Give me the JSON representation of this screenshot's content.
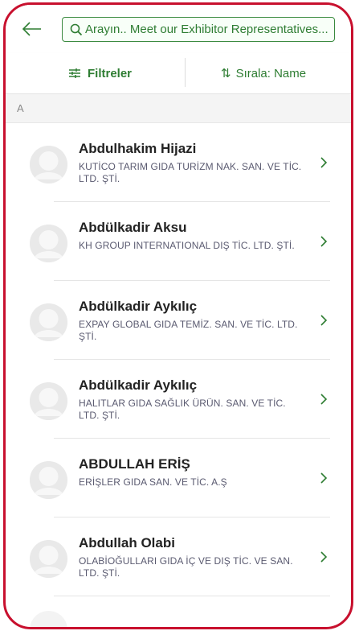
{
  "header": {
    "search": {
      "text": "Arayın.. Meet our Exhibitor Representatives..."
    }
  },
  "toolbar": {
    "filter_label": "Filtreler",
    "sort_label": "Sırala: Name"
  },
  "section": {
    "letter": "A"
  },
  "contacts": [
    {
      "name": "Abdulhakim Hijazi",
      "company": "KUTİCO TARIM GIDA TURİZM NAK. SAN. VE TİC. LTD. ŞTİ."
    },
    {
      "name": "Abdülkadir Aksu",
      "company": "KH GROUP INTERNATIONAL DIŞ TİC. LTD. ŞTİ."
    },
    {
      "name": "Abdülkadir Aykılıç",
      "company": "EXPAY GLOBAL GIDA TEMİZ. SAN. VE TİC. LTD. ŞTİ."
    },
    {
      "name": "Abdülkadir Aykılıç",
      "company": "HALITLAR GIDA SAĞLIK ÜRÜN. SAN. VE TİC. LTD. ŞTİ."
    },
    {
      "name": "ABDULLAH ERİŞ",
      "company": "ERİŞLER GIDA SAN. VE TİC. A.Ş"
    },
    {
      "name": "Abdullah Olabi",
      "company": "OLABİOĞULLARI GIDA İÇ VE DIŞ TİC. VE SAN. LTD. ŞTİ."
    }
  ],
  "colors": {
    "accent_green": "#2e7d32",
    "frame_red": "#c8102e"
  }
}
